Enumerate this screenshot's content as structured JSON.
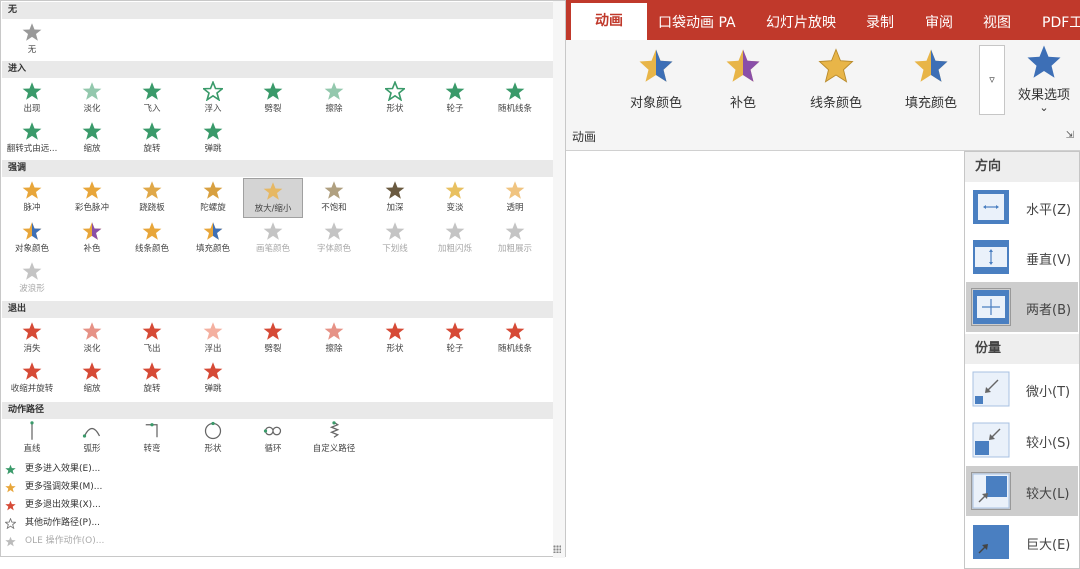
{
  "gallery": {
    "sections": [
      {
        "title": "无",
        "items": [
          {
            "label": "无"
          }
        ]
      },
      {
        "title": "进入",
        "items": [
          {
            "label": "出现"
          },
          {
            "label": "淡化"
          },
          {
            "label": "飞入"
          },
          {
            "label": "浮入"
          },
          {
            "label": "劈裂"
          },
          {
            "label": "擦除"
          },
          {
            "label": "形状"
          },
          {
            "label": "轮子"
          },
          {
            "label": "随机线条"
          },
          {
            "label": "翻转式由远..."
          },
          {
            "label": "缩放"
          },
          {
            "label": "旋转"
          },
          {
            "label": "弹跳"
          }
        ]
      },
      {
        "title": "强调",
        "items": [
          {
            "label": "脉冲"
          },
          {
            "label": "彩色脉冲"
          },
          {
            "label": "跷跷板"
          },
          {
            "label": "陀螺旋"
          },
          {
            "label": "放大/缩小"
          },
          {
            "label": "不饱和"
          },
          {
            "label": "加深"
          },
          {
            "label": "变淡"
          },
          {
            "label": "透明"
          },
          {
            "label": "对象颜色"
          },
          {
            "label": "补色"
          },
          {
            "label": "线条颜色"
          },
          {
            "label": "填充颜色"
          },
          {
            "label": "画笔颜色"
          },
          {
            "label": "字体颜色"
          },
          {
            "label": "下划线"
          },
          {
            "label": "加粗闪烁"
          },
          {
            "label": "加粗展示"
          },
          {
            "label": "波浪形"
          }
        ]
      },
      {
        "title": "退出",
        "items": [
          {
            "label": "消失"
          },
          {
            "label": "淡化"
          },
          {
            "label": "飞出"
          },
          {
            "label": "浮出"
          },
          {
            "label": "劈裂"
          },
          {
            "label": "擦除"
          },
          {
            "label": "形状"
          },
          {
            "label": "轮子"
          },
          {
            "label": "随机线条"
          },
          {
            "label": "收缩并旋转"
          },
          {
            "label": "缩放"
          },
          {
            "label": "旋转"
          },
          {
            "label": "弹跳"
          }
        ]
      },
      {
        "title": "动作路径",
        "items": [
          {
            "label": "直线"
          },
          {
            "label": "弧形"
          },
          {
            "label": "转弯"
          },
          {
            "label": "形状"
          },
          {
            "label": "循环"
          },
          {
            "label": "自定义路径"
          }
        ]
      }
    ],
    "more": [
      {
        "label": "更多进入效果(E)...",
        "color": "#3a9a6a"
      },
      {
        "label": "更多强调效果(M)...",
        "color": "#e8a63a"
      },
      {
        "label": "更多退出效果(X)...",
        "color": "#d64a36"
      },
      {
        "label": "其他动作路径(P)...",
        "color": "#777777"
      },
      {
        "label": "OLE 操作动作(O)...",
        "color": "#bbbbbb"
      }
    ]
  },
  "ribbon": {
    "tabs": [
      {
        "label": "动画"
      },
      {
        "label": "口袋动画 PA"
      },
      {
        "label": "幻灯片放映"
      },
      {
        "label": "录制"
      },
      {
        "label": "审阅"
      },
      {
        "label": "视图"
      },
      {
        "label": "PDF工"
      }
    ],
    "buttons": [
      {
        "label": "对象颜色"
      },
      {
        "label": "补色"
      },
      {
        "label": "线条颜色"
      },
      {
        "label": "填充颜色"
      }
    ],
    "effect_options": {
      "label": "效果选项",
      "chevron": "⌄"
    },
    "gallery_more": "▿",
    "group_label": "动画",
    "launcher": "⇲"
  },
  "menu": {
    "direction_header": "方向",
    "direction_items": [
      {
        "label": "水平(Z)"
      },
      {
        "label": "垂直(V)"
      },
      {
        "label": "两者(B)"
      }
    ],
    "amount_header": "份量",
    "amount_items": [
      {
        "label": "微小(T)"
      },
      {
        "label": "较小(S)"
      },
      {
        "label": "较大(L)"
      },
      {
        "label": "巨大(E)"
      }
    ]
  },
  "colors": {
    "accent": "#c0392b",
    "entrance": "#3a9a6a",
    "emphasis": "#e8a63a",
    "exit": "#d64a36",
    "path": "#777777",
    "disabled": "#c4c4c4"
  }
}
